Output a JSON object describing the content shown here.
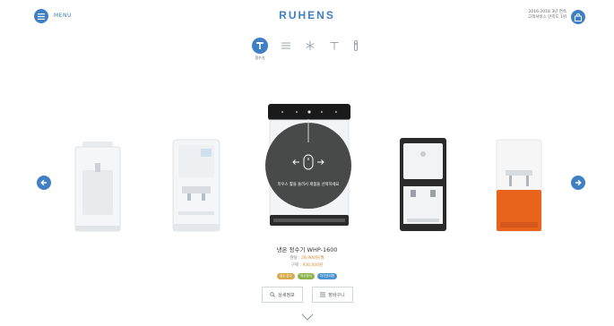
{
  "header": {
    "menu_icon": "hamburger-icon",
    "menu_label": "MENU",
    "logo": "RUHENS",
    "notice_line1": "2016·2018 3년 연속",
    "notice_line2": "고객서비스 만족도 1위",
    "cart_icon": "bag-icon"
  },
  "categories": {
    "active_label": "정수기",
    "items": [
      {
        "name": "water-purifier",
        "icon": "purifier-icon"
      },
      {
        "name": "air-purifier",
        "icon": "lines-icon"
      },
      {
        "name": "ice-maker",
        "icon": "snowflake-icon"
      },
      {
        "name": "faucet",
        "icon": "faucet-icon"
      },
      {
        "name": "filter",
        "icon": "filter-icon"
      }
    ]
  },
  "overlay": {
    "text": "미우스 휠을 돌려서 제품을 선택하세요"
  },
  "product": {
    "name": "냉온 정수기 WHP-1600",
    "rental_label": "렌탈 :",
    "rental_value": "29,900원/월",
    "purchase_label": "구매 :",
    "purchase_value": "930,000원",
    "tags": [
      {
        "label": "냉수·온수",
        "color": "#d6a94b"
      },
      {
        "label": "직수방식",
        "color": "#8db24e"
      },
      {
        "label": "자가관리형",
        "color": "#4a93cf"
      }
    ],
    "detail_button": "상세정보",
    "compare_button": "장바구니"
  },
  "colors": {
    "accent": "#3f7fc4",
    "orange_unit": "#e8641c"
  }
}
